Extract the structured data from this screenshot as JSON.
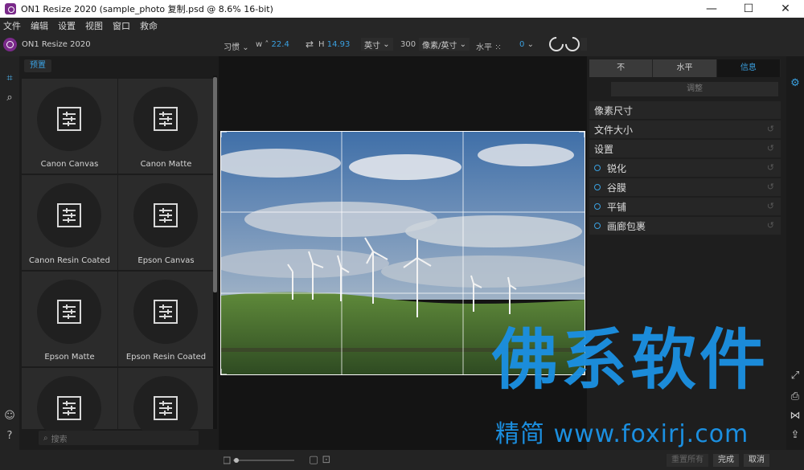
{
  "window": {
    "title": "ON1 Resize 2020 (sample_photo 复制.psd @ 8.6% 16-bit)",
    "minimize": "—",
    "maximize": "☐",
    "close": "✕"
  },
  "menu": [
    "文件",
    "编辑",
    "设置",
    "视图",
    "窗口",
    "救命"
  ],
  "toolbar": {
    "brand": "ON1 Resize 2020",
    "preset_label": "习惯",
    "width_label": "w ˄",
    "width_value": "22.4",
    "height_label": "H",
    "height_value": "14.93",
    "unit": "英寸",
    "resolution": "300",
    "resolution_unit": "像素/英寸",
    "orientation": "水平",
    "rotation_value": "0"
  },
  "presets": {
    "tab": "预置",
    "items": [
      "Canon Canvas",
      "Canon Matte",
      "Canon Resin Coated",
      "Epson Canvas",
      "Epson Matte",
      "Epson Resin Coated",
      "",
      ""
    ],
    "search_placeholder": "搜索"
  },
  "right_panel": {
    "tabs": [
      "不",
      "水平",
      "信息"
    ],
    "adjust": "调整",
    "sections": [
      {
        "label": "像素尺寸",
        "dot": false,
        "reset": false
      },
      {
        "label": "文件大小",
        "dot": false,
        "reset": true
      },
      {
        "label": "设置",
        "dot": false,
        "reset": true
      },
      {
        "label": "锐化",
        "dot": true,
        "reset": true
      },
      {
        "label": "谷膜",
        "dot": true,
        "reset": true
      },
      {
        "label": "平铺",
        "dot": true,
        "reset": true
      },
      {
        "label": "画廊包裹",
        "dot": true,
        "reset": true
      }
    ]
  },
  "bottom": {
    "reset_all": "重置所有",
    "done": "完成",
    "cancel": "取消"
  },
  "watermark": {
    "main": "佛系软件",
    "sub": "精简 www.foxirj.com"
  },
  "colors": {
    "accent": "#3aa0e0",
    "brand": "#7a2a8a",
    "watermark": "#1b8fe0"
  }
}
